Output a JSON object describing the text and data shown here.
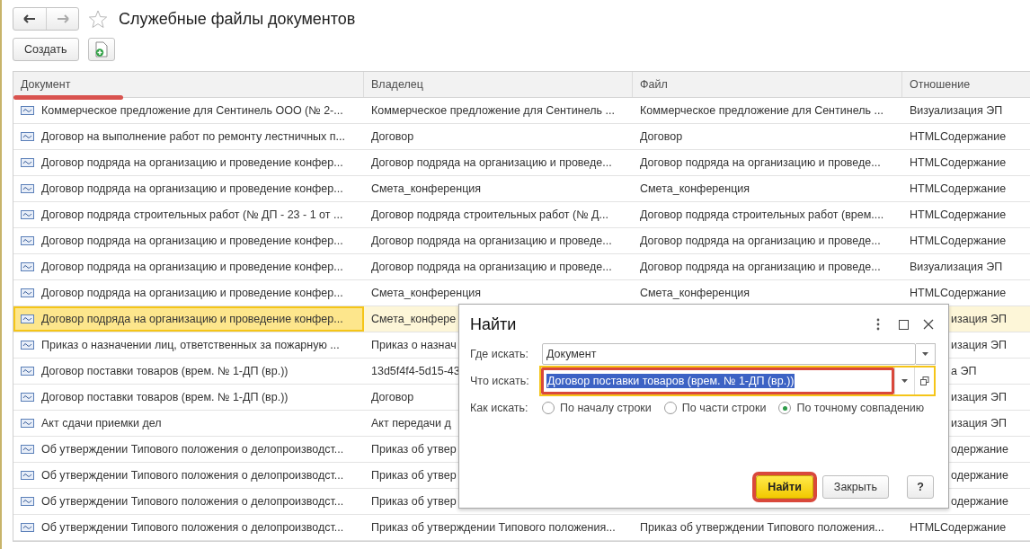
{
  "page": {
    "title": "Служебные файлы документов",
    "favorite": false
  },
  "toolbar": {
    "create_button": "Создать"
  },
  "table": {
    "columns": [
      {
        "label": "Документ",
        "underlined": true
      },
      {
        "label": "Владелец",
        "underlined": false
      },
      {
        "label": "Файл",
        "underlined": false
      },
      {
        "label": "Отношение",
        "underlined": false
      }
    ],
    "rows": [
      {
        "document": "Коммерческое предложение для Сентинель ООО (№ 2-...",
        "owner": "Коммерческое предложение для Сентинель ...",
        "file": "Коммерческое предложение для Сентинель ...",
        "relation": "Визуализация ЭП",
        "selected": false,
        "covered": false
      },
      {
        "document": "Договор на выполнение работ по ремонту лестничных п...",
        "owner": "Договор",
        "file": "Договор",
        "relation": "HTMLСодержание",
        "selected": false,
        "covered": false
      },
      {
        "document": "Договор подряда на организацию и проведение конфер...",
        "owner": "Договор подряда на организацию и проведе...",
        "file": "Договор подряда на организацию и проведе...",
        "relation": "HTMLСодержание",
        "selected": false,
        "covered": false
      },
      {
        "document": "Договор подряда на организацию и проведение конфер...",
        "owner": "Смета_конференция",
        "file": "Смета_конференция",
        "relation": "HTMLСодержание",
        "selected": false,
        "covered": false
      },
      {
        "document": "Договор подряда строительных работ (№ ДП - 23 - 1 от ...",
        "owner": "Договор подряда строительных работ (№ Д...",
        "file": "Договор подряда строительных работ (врем....",
        "relation": "HTMLСодержание",
        "selected": false,
        "covered": false
      },
      {
        "document": "Договор подряда на организацию и проведение конфер...",
        "owner": "Договор подряда на организацию и проведе...",
        "file": "Договор подряда на организацию и проведе...",
        "relation": "HTMLСодержание",
        "selected": false,
        "covered": false
      },
      {
        "document": "Договор подряда на организацию и проведение конфер...",
        "owner": "Договор подряда на организацию и проведе...",
        "file": "Договор подряда на организацию и проведе...",
        "relation": "Визуализация ЭП",
        "selected": false,
        "covered": false
      },
      {
        "document": "Договор подряда на организацию и проведение конфер...",
        "owner": "Смета_конференция",
        "file": "Смета_конференция",
        "relation": "HTMLСодержание",
        "selected": false,
        "covered": false
      },
      {
        "document": "Договор подряда на организацию и проведение конфер...",
        "owner": "Смета_конфере",
        "relation": "изация ЭП",
        "selected": true,
        "covered": true
      },
      {
        "document": "Приказ о назначении лиц, ответственных за пожарную ...",
        "owner": "Приказ о назнач",
        "relation": "изация ЭП",
        "selected": false,
        "covered": true
      },
      {
        "document": "Договор поставки товаров (врем. № 1-ДП (вр.))",
        "owner": "13d5f4f4-5d15-43",
        "relation": "а ЭП",
        "selected": false,
        "covered": true
      },
      {
        "document": "Договор поставки товаров (врем. № 1-ДП (вр.))",
        "owner": "Договор",
        "relation": "изация ЭП",
        "selected": false,
        "covered": true
      },
      {
        "document": "Акт сдачи приемки дел",
        "owner": "Акт передачи д",
        "relation": "изация ЭП",
        "selected": false,
        "covered": true
      },
      {
        "document": "Об утверждении Типового положения о делопроизводст...",
        "owner": "Приказ об утвер",
        "relation": "одержание",
        "selected": false,
        "covered": true
      },
      {
        "document": "Об утверждении Типового положения о делопроизводст...",
        "owner": "Приказ об утвер",
        "relation": "одержание",
        "selected": false,
        "covered": true
      },
      {
        "document": "Об утверждении Типового положения о делопроизводст...",
        "owner": "Приказ об утвер",
        "relation": "одержание",
        "selected": false,
        "covered": true
      },
      {
        "document": "Об утверждении Типового положения о делопроизводст...",
        "owner": "Приказ об утверждении Типового положения...",
        "file": "Приказ об утверждении Типового положения...",
        "relation": "HTMLСодержание",
        "selected": false,
        "covered": false
      }
    ]
  },
  "dialog": {
    "title": "Найти",
    "fields": [
      {
        "label": "Где искать:",
        "value": "Документ",
        "highlighted": false,
        "text_selected": false,
        "open_button": false
      },
      {
        "label": "Что искать:",
        "value": "Договор поставки товаров (врем. № 1-ДП (вр.))",
        "highlighted": true,
        "text_selected": true,
        "open_button": true
      }
    ],
    "search_mode": {
      "label": "Как искать:",
      "options": [
        {
          "label": "По началу строки",
          "selected": false
        },
        {
          "label": "По части строки",
          "selected": false
        },
        {
          "label": "По точному совпадению",
          "selected": true
        }
      ]
    },
    "buttons": [
      {
        "label": "Найти",
        "kind": "default",
        "highlighted": true
      },
      {
        "label": "Закрыть",
        "kind": "plain",
        "highlighted": false
      },
      {
        "label": "?",
        "kind": "help",
        "highlighted": false
      }
    ]
  }
}
